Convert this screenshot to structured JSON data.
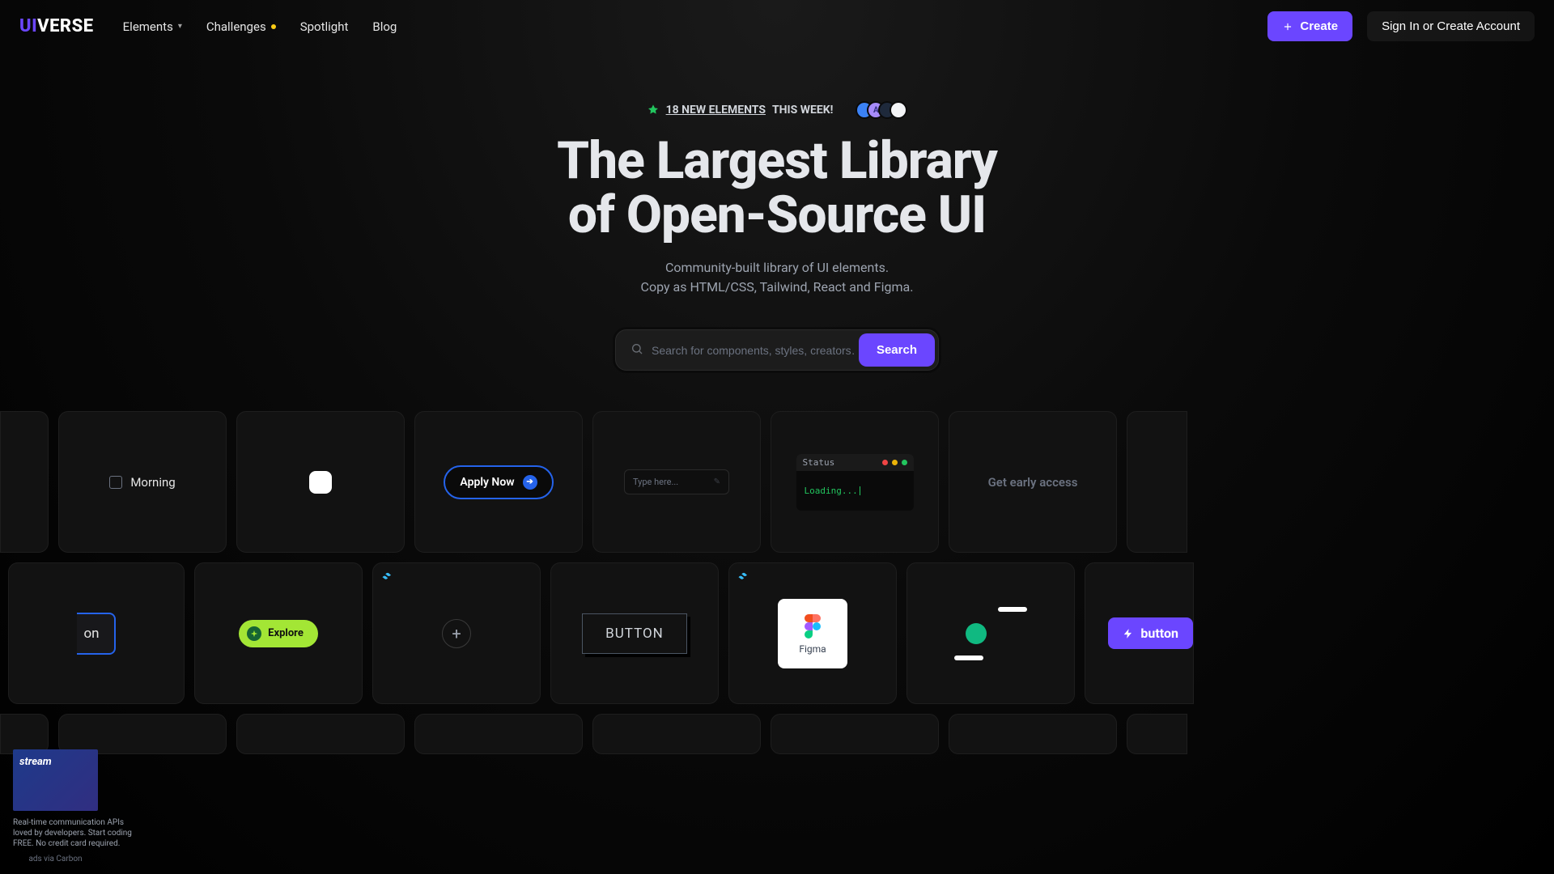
{
  "header": {
    "logo_prefix": "UI",
    "logo_suffix": "VERSE",
    "nav": {
      "elements": "Elements",
      "challenges": "Challenges",
      "spotlight": "Spotlight",
      "blog": "Blog"
    },
    "create": "Create",
    "signin": "Sign In or Create Account"
  },
  "hero": {
    "announce_link": "18 NEW ELEMENTS",
    "announce_rest": " THIS WEEK!",
    "avatars": [
      {
        "bg": "#3b82f6",
        "initial": "A"
      },
      {
        "bg": "#a78bfa",
        "initial": ""
      },
      {
        "bg": "#1e293b",
        "initial": ""
      },
      {
        "bg": "#f3f4f6",
        "initial": ""
      }
    ],
    "title_l1": "The Largest Library",
    "title_l2": "of Open-Source UI",
    "sub_l1": "Community-built library of UI elements.",
    "sub_l2": "Copy as HTML/CSS, Tailwind, React and Figma."
  },
  "search": {
    "placeholder": "Search for components, styles, creators…",
    "button": "Search"
  },
  "cards": {
    "morning": "Morning",
    "apply": "Apply Now",
    "type_placeholder": "Type here...",
    "terminal_status": "Status",
    "terminal_body": "Loading...",
    "early": "Get early access",
    "on_fragment": "on",
    "explore": "Explore",
    "button_label": "BUTTON",
    "figma": "Figma",
    "glow": "button"
  },
  "ad": {
    "text": "Real-time communication APIs loved by developers. Start coding FREE. No credit card required.",
    "credit": "ads via Carbon"
  },
  "colors": {
    "accent": "#6b46ff",
    "tailwind": "#38bdf8"
  }
}
